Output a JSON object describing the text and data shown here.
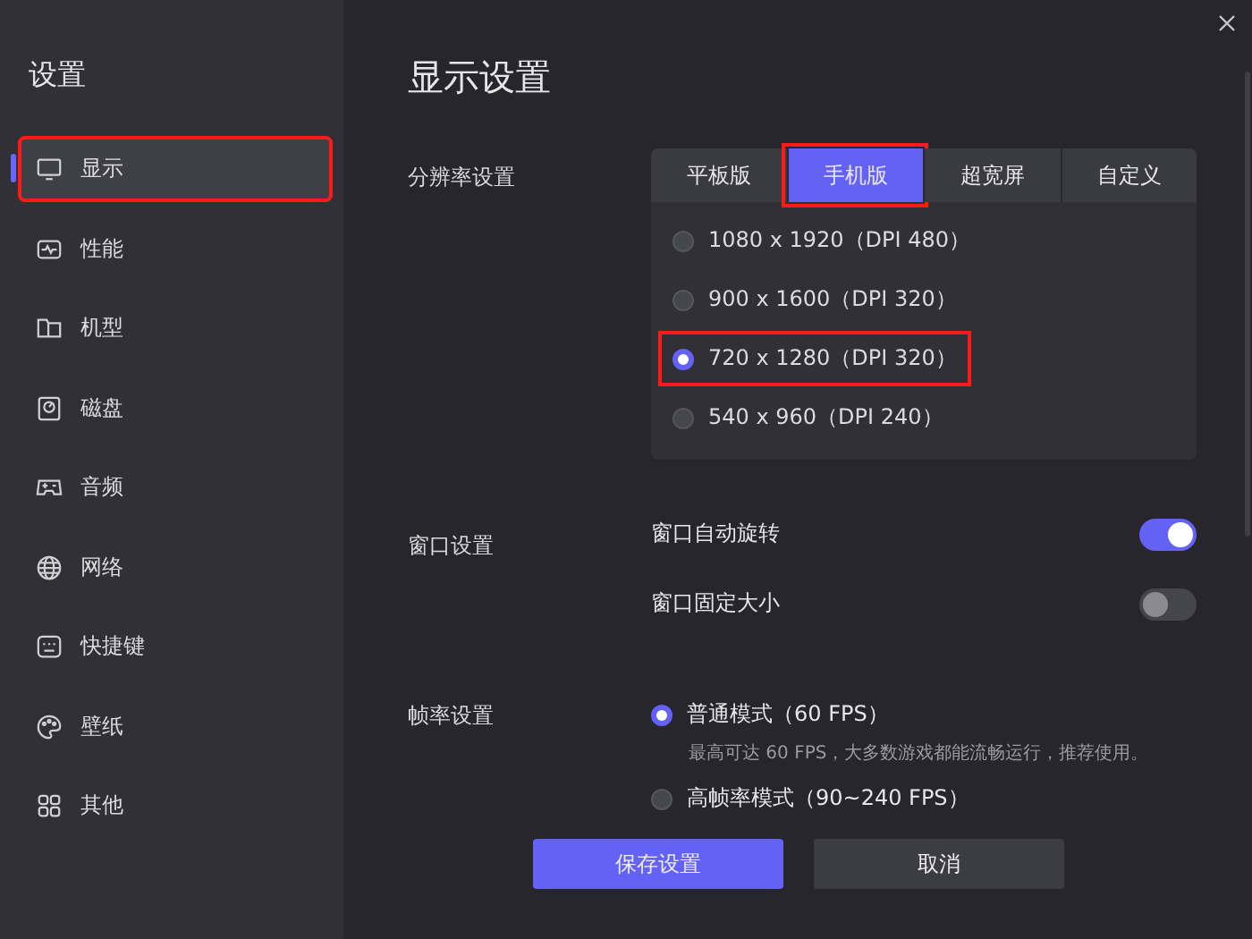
{
  "sidebar": {
    "title": "设置",
    "items": [
      {
        "label": "显示",
        "selected": true,
        "highlighted": true
      },
      {
        "label": "性能",
        "selected": false,
        "highlighted": false
      },
      {
        "label": "机型",
        "selected": false,
        "highlighted": false
      },
      {
        "label": "磁盘",
        "selected": false,
        "highlighted": false
      },
      {
        "label": "音频",
        "selected": false,
        "highlighted": false
      },
      {
        "label": "网络",
        "selected": false,
        "highlighted": false
      },
      {
        "label": "快捷键",
        "selected": false,
        "highlighted": false
      },
      {
        "label": "壁纸",
        "selected": false,
        "highlighted": false
      },
      {
        "label": "其他",
        "selected": false,
        "highlighted": false
      }
    ]
  },
  "page": {
    "title": "显示设置",
    "resolution": {
      "label": "分辨率设置",
      "tabs": [
        {
          "label": "平板版",
          "selected": false,
          "highlighted": false
        },
        {
          "label": "手机版",
          "selected": true,
          "highlighted": true
        },
        {
          "label": "超宽屏",
          "selected": false,
          "highlighted": false
        },
        {
          "label": "自定义",
          "selected": false,
          "highlighted": false
        }
      ],
      "options": [
        {
          "label": "1080 x 1920（DPI 480）",
          "selected": false,
          "highlighted": false
        },
        {
          "label": "900 x 1600（DPI 320）",
          "selected": false,
          "highlighted": false
        },
        {
          "label": "720 x 1280（DPI 320）",
          "selected": true,
          "highlighted": true
        },
        {
          "label": "540 x 960（DPI 240）",
          "selected": false,
          "highlighted": false
        }
      ]
    },
    "window": {
      "label": "窗口设置",
      "toggles": [
        {
          "label": "窗口自动旋转",
          "on": true
        },
        {
          "label": "窗口固定大小",
          "on": false
        }
      ]
    },
    "framerate": {
      "label": "帧率设置",
      "options": [
        {
          "label": "普通模式（60 FPS）",
          "description": "最高可达 60 FPS，大多数游戏都能流畅运行，推荐使用。",
          "selected": true
        },
        {
          "label": "高帧率模式（90~240 FPS）",
          "selected": false
        }
      ]
    }
  },
  "buttons": [
    {
      "label": "保存设置",
      "kind": "primary"
    },
    {
      "label": "取消",
      "kind": "secondary"
    }
  ]
}
